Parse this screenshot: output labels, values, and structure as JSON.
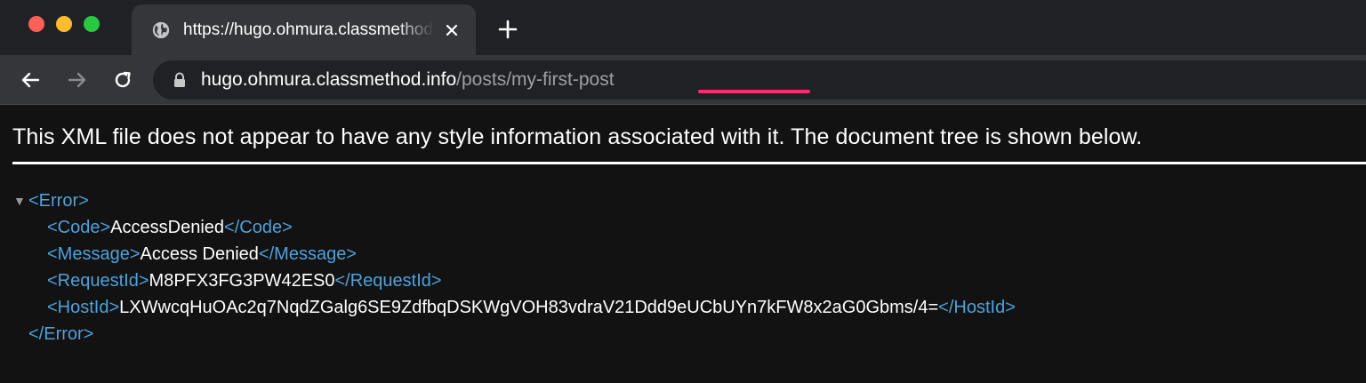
{
  "window": {
    "tab": {
      "title": "https://hugo.ohmura.classmethod.info/posts/my-first-post"
    },
    "address_bar": {
      "host": "hugo.ohmura.classmethod.info",
      "path": "/posts/my-first-post"
    },
    "colors": {
      "traffic_red": "#fe5f57",
      "traffic_yellow": "#febc2e",
      "traffic_green": "#28c840",
      "highlight_underline": "#ff2a6d"
    }
  },
  "page": {
    "notice": "This XML file does not appear to have any style information associated with it. The document tree is shown below.",
    "xml": {
      "root_open": "<Error>",
      "root_close": "</Error>",
      "children": [
        {
          "open": "<Code>",
          "value": "AccessDenied",
          "close": "</Code>"
        },
        {
          "open": "<Message>",
          "value": "Access Denied",
          "close": "</Message>"
        },
        {
          "open": "<RequestId>",
          "value": "M8PFX3FG3PW42ES0",
          "close": "</RequestId>"
        },
        {
          "open": "<HostId>",
          "value": "LXWwcqHuOAc2q7NqdZGalg6SE9ZdfbqDSKWgVOH83vdraV21Ddd9eUCbUYn7kFW8x2aG0Gbms/4=",
          "close": "</HostId>"
        }
      ],
      "toggle_icon": "▼",
      "tag_color": "#4ea1db"
    }
  }
}
